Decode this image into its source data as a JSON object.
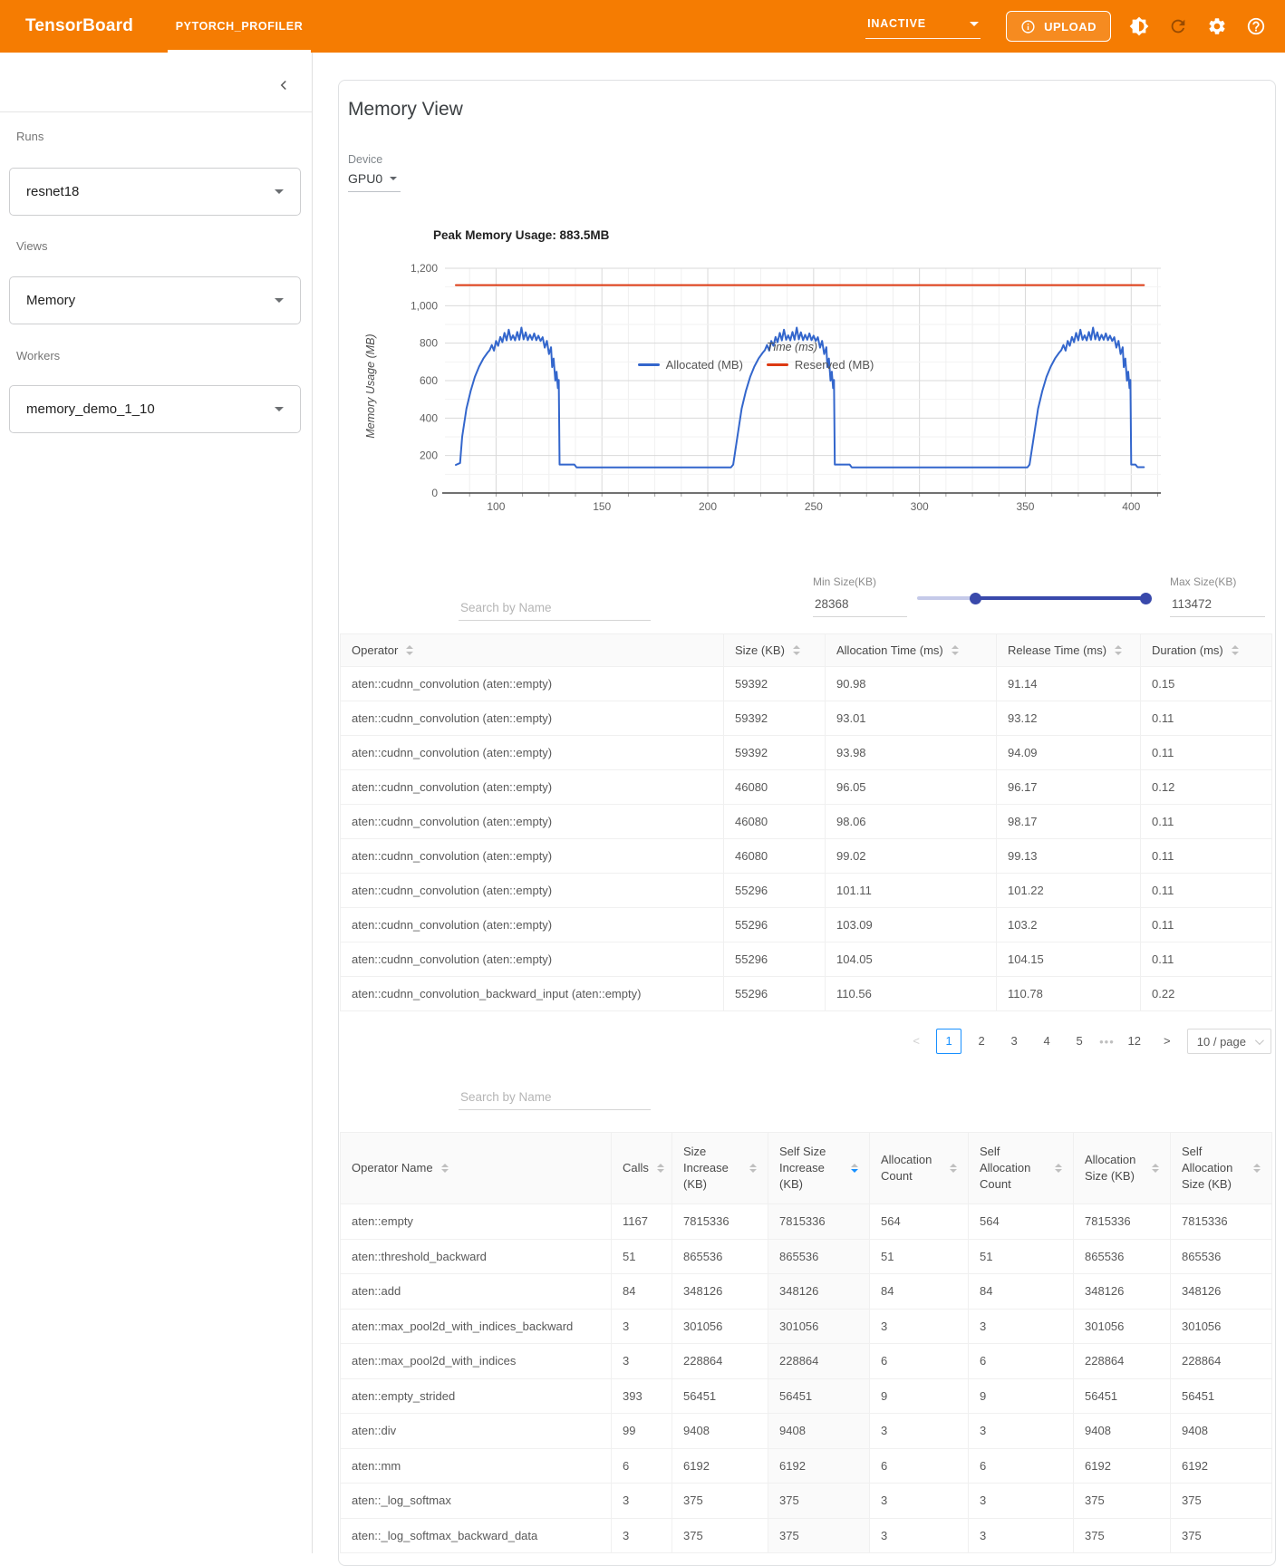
{
  "header": {
    "logo": "TensorBoard",
    "tab": "PYTORCH_PROFILER",
    "status": "INACTIVE",
    "upload_label": "UPLOAD"
  },
  "sidebar": {
    "runs_label": "Runs",
    "runs_value": "resnet18",
    "views_label": "Views",
    "views_value": "Memory",
    "workers_label": "Workers",
    "workers_value": "memory_demo_1_10"
  },
  "main": {
    "title": "Memory View",
    "device_label": "Device",
    "device_value": "GPU0"
  },
  "chart_data": {
    "type": "line",
    "title": "Peak Memory Usage: 883.5MB",
    "xlabel": "Time (ms)",
    "ylabel": "Memory Usage (MB)",
    "xlim": [
      78,
      414
    ],
    "ylim": [
      0,
      1200
    ],
    "xticks": [
      100,
      150,
      200,
      250,
      300,
      350,
      400
    ],
    "yticks": [
      0,
      200,
      400,
      600,
      800,
      1000,
      1200
    ],
    "ytick_labels": [
      "0",
      "200",
      "400",
      "600",
      "800",
      "1,000",
      "1,200"
    ],
    "grid": true,
    "legend_position": "bottom",
    "series": [
      {
        "name": "Allocated (MB)",
        "color": "#3366cc",
        "points": [
          [
            81,
            150
          ],
          [
            83,
            160
          ],
          [
            84,
            300
          ],
          [
            86,
            450
          ],
          [
            88,
            545
          ],
          [
            90,
            620
          ],
          [
            92,
            675
          ],
          [
            94,
            718
          ],
          [
            96,
            750
          ],
          [
            97,
            763
          ],
          [
            98,
            790
          ],
          [
            99,
            760
          ],
          [
            100,
            812
          ],
          [
            101,
            786
          ],
          [
            102,
            833
          ],
          [
            103,
            805
          ],
          [
            104,
            855
          ],
          [
            105,
            815
          ],
          [
            106,
            872
          ],
          [
            107,
            818
          ],
          [
            108,
            842
          ],
          [
            109,
            815
          ],
          [
            110,
            860
          ],
          [
            111,
            818
          ],
          [
            112,
            883
          ],
          [
            113,
            820
          ],
          [
            114,
            858
          ],
          [
            115,
            816
          ],
          [
            116,
            845
          ],
          [
            117,
            818
          ],
          [
            118,
            852
          ],
          [
            119,
            816
          ],
          [
            120,
            840
          ],
          [
            121,
            812
          ],
          [
            122,
            832
          ],
          [
            123,
            776
          ],
          [
            124,
            812
          ],
          [
            125,
            742
          ],
          [
            126,
            778
          ],
          [
            126.5,
            672
          ],
          [
            127.2,
            718
          ],
          [
            128,
            600
          ],
          [
            128.6,
            648
          ],
          [
            129.2,
            560
          ],
          [
            129.6,
            604
          ],
          [
            130,
            152
          ],
          [
            133,
            152
          ],
          [
            137,
            152
          ],
          [
            138,
            137
          ],
          [
            211,
            137
          ],
          [
            212,
            152
          ],
          [
            214,
            300
          ],
          [
            216,
            450
          ],
          [
            218,
            545
          ],
          [
            220,
            620
          ],
          [
            222,
            675
          ],
          [
            224,
            718
          ],
          [
            226,
            750
          ],
          [
            227,
            763
          ],
          [
            228,
            790
          ],
          [
            229,
            760
          ],
          [
            230,
            812
          ],
          [
            231,
            786
          ],
          [
            232,
            833
          ],
          [
            233,
            805
          ],
          [
            234,
            855
          ],
          [
            235,
            815
          ],
          [
            236,
            872
          ],
          [
            237,
            818
          ],
          [
            238,
            842
          ],
          [
            239,
            815
          ],
          [
            240,
            860
          ],
          [
            241,
            818
          ],
          [
            242,
            883
          ],
          [
            243,
            820
          ],
          [
            244,
            858
          ],
          [
            245,
            816
          ],
          [
            246,
            845
          ],
          [
            247,
            818
          ],
          [
            248,
            852
          ],
          [
            249,
            816
          ],
          [
            250,
            840
          ],
          [
            251,
            812
          ],
          [
            252,
            832
          ],
          [
            253,
            776
          ],
          [
            254,
            812
          ],
          [
            255,
            742
          ],
          [
            256,
            778
          ],
          [
            256.5,
            672
          ],
          [
            257.2,
            718
          ],
          [
            258,
            600
          ],
          [
            258.6,
            648
          ],
          [
            259.2,
            560
          ],
          [
            259.6,
            604
          ],
          [
            260,
            152
          ],
          [
            263,
            152
          ],
          [
            267,
            152
          ],
          [
            268,
            137
          ],
          [
            351,
            137
          ],
          [
            352,
            152
          ],
          [
            354,
            300
          ],
          [
            356,
            450
          ],
          [
            358,
            545
          ],
          [
            360,
            620
          ],
          [
            362,
            675
          ],
          [
            364,
            718
          ],
          [
            366,
            750
          ],
          [
            367,
            763
          ],
          [
            368,
            790
          ],
          [
            369,
            760
          ],
          [
            370,
            812
          ],
          [
            371,
            786
          ],
          [
            372,
            833
          ],
          [
            373,
            805
          ],
          [
            374,
            855
          ],
          [
            375,
            815
          ],
          [
            376,
            872
          ],
          [
            377,
            818
          ],
          [
            378,
            842
          ],
          [
            379,
            815
          ],
          [
            380,
            860
          ],
          [
            381,
            818
          ],
          [
            382,
            883
          ],
          [
            383,
            820
          ],
          [
            384,
            858
          ],
          [
            385,
            816
          ],
          [
            386,
            845
          ],
          [
            387,
            818
          ],
          [
            388,
            852
          ],
          [
            389,
            816
          ],
          [
            390,
            840
          ],
          [
            391,
            812
          ],
          [
            392,
            832
          ],
          [
            393,
            776
          ],
          [
            394,
            812
          ],
          [
            395,
            742
          ],
          [
            396,
            778
          ],
          [
            396.5,
            672
          ],
          [
            397.2,
            718
          ],
          [
            398,
            600
          ],
          [
            398.6,
            648
          ],
          [
            399.2,
            560
          ],
          [
            399.6,
            604
          ],
          [
            400,
            152
          ],
          [
            402,
            152
          ],
          [
            403,
            138
          ],
          [
            406,
            138
          ]
        ]
      },
      {
        "name": "Reserved (MB)",
        "color": "#dc3912",
        "points": [
          [
            81,
            1110
          ],
          [
            406,
            1110
          ]
        ]
      }
    ]
  },
  "controls": {
    "search_placeholder": "Search by Name",
    "min_label": "Min Size(KB)",
    "min_value": "28368",
    "max_label": "Max Size(KB)",
    "max_value": "113472",
    "slider_min_percent": 25,
    "slider_max_percent": 100
  },
  "table1": {
    "columns": [
      {
        "label": "Operator"
      },
      {
        "label": "Size (KB)"
      },
      {
        "label": "Allocation Time (ms)"
      },
      {
        "label": "Release Time (ms)"
      },
      {
        "label": "Duration (ms)"
      }
    ],
    "rows": [
      [
        "aten::cudnn_convolution (aten::empty)",
        "59392",
        "90.98",
        "91.14",
        "0.15"
      ],
      [
        "aten::cudnn_convolution (aten::empty)",
        "59392",
        "93.01",
        "93.12",
        "0.11"
      ],
      [
        "aten::cudnn_convolution (aten::empty)",
        "59392",
        "93.98",
        "94.09",
        "0.11"
      ],
      [
        "aten::cudnn_convolution (aten::empty)",
        "46080",
        "96.05",
        "96.17",
        "0.12"
      ],
      [
        "aten::cudnn_convolution (aten::empty)",
        "46080",
        "98.06",
        "98.17",
        "0.11"
      ],
      [
        "aten::cudnn_convolution (aten::empty)",
        "46080",
        "99.02",
        "99.13",
        "0.11"
      ],
      [
        "aten::cudnn_convolution (aten::empty)",
        "55296",
        "101.11",
        "101.22",
        "0.11"
      ],
      [
        "aten::cudnn_convolution (aten::empty)",
        "55296",
        "103.09",
        "103.2",
        "0.11"
      ],
      [
        "aten::cudnn_convolution (aten::empty)",
        "55296",
        "104.05",
        "104.15",
        "0.11"
      ],
      [
        "aten::cudnn_convolution_backward_input (aten::empty)",
        "55296",
        "110.56",
        "110.78",
        "0.22"
      ]
    ]
  },
  "pagination": {
    "prev": "<",
    "pages": [
      "1",
      "2",
      "3",
      "4",
      "5",
      "•••",
      "12"
    ],
    "active": "1",
    "next": ">",
    "page_size": "10 / page"
  },
  "table2": {
    "search_placeholder": "Search by Name",
    "columns": [
      {
        "label": "Operator Name"
      },
      {
        "label": "Calls"
      },
      {
        "label": "Size Increase (KB)"
      },
      {
        "label": "Self Size Increase (KB)",
        "sorted": "desc"
      },
      {
        "label": "Allocation Count"
      },
      {
        "label": "Self Allocation Count"
      },
      {
        "label": "Allocation Size (KB)"
      },
      {
        "label": "Self Allocation Size (KB)"
      }
    ],
    "rows": [
      [
        "aten::empty",
        "1167",
        "7815336",
        "7815336",
        "564",
        "564",
        "7815336",
        "7815336"
      ],
      [
        "aten::threshold_backward",
        "51",
        "865536",
        "865536",
        "51",
        "51",
        "865536",
        "865536"
      ],
      [
        "aten::add",
        "84",
        "348126",
        "348126",
        "84",
        "84",
        "348126",
        "348126"
      ],
      [
        "aten::max_pool2d_with_indices_backward",
        "3",
        "301056",
        "301056",
        "3",
        "3",
        "301056",
        "301056"
      ],
      [
        "aten::max_pool2d_with_indices",
        "3",
        "228864",
        "228864",
        "6",
        "6",
        "228864",
        "228864"
      ],
      [
        "aten::empty_strided",
        "393",
        "56451",
        "56451",
        "9",
        "9",
        "56451",
        "56451"
      ],
      [
        "aten::div",
        "99",
        "9408",
        "9408",
        "3",
        "3",
        "9408",
        "9408"
      ],
      [
        "aten::mm",
        "6",
        "6192",
        "6192",
        "6",
        "6",
        "6192",
        "6192"
      ],
      [
        "aten::_log_softmax",
        "3",
        "375",
        "375",
        "3",
        "3",
        "375",
        "375"
      ],
      [
        "aten::_log_softmax_backward_data",
        "3",
        "375",
        "375",
        "3",
        "3",
        "375",
        "375"
      ]
    ]
  }
}
